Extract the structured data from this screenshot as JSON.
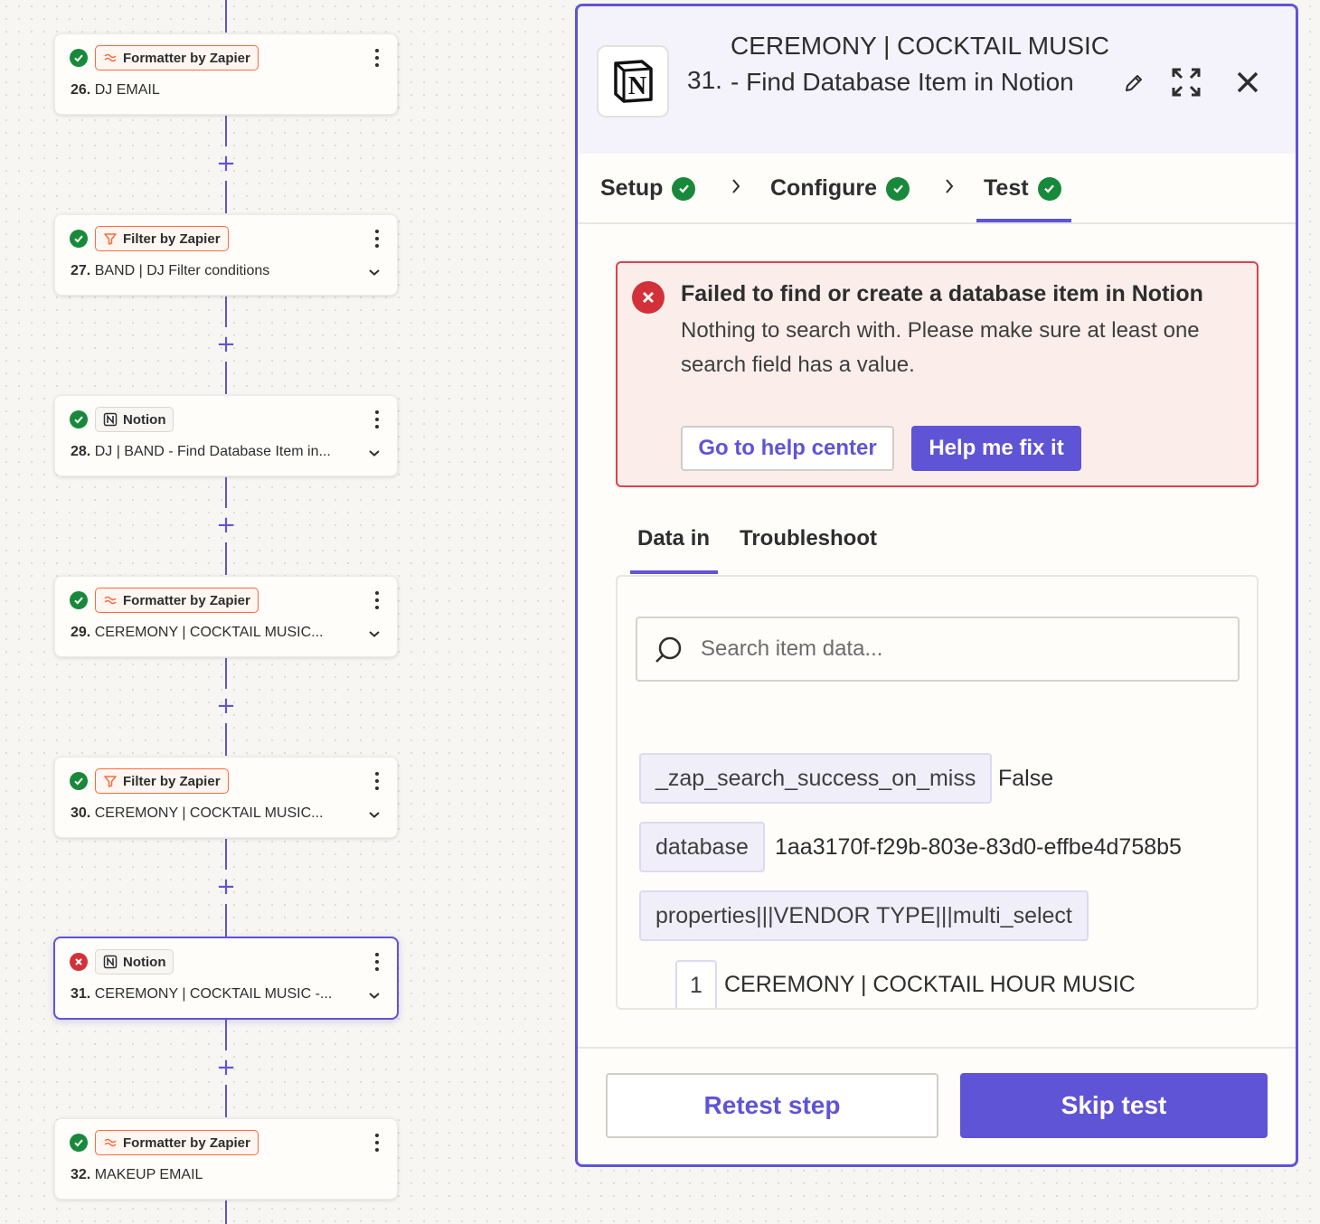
{
  "steps": [
    {
      "status": "success",
      "app": "Formatter by Zapier",
      "app_icon": "formatter-icon",
      "number": "26.",
      "title": "DJ EMAIL",
      "has_chevron": false
    },
    {
      "status": "success",
      "app": "Filter by Zapier",
      "app_icon": "filter-icon",
      "number": "27.",
      "title": "BAND | DJ Filter conditions",
      "has_chevron": true
    },
    {
      "status": "success",
      "app": "Notion",
      "app_icon": "notion-icon",
      "number": "28.",
      "title": "DJ | BAND - Find Database Item in...",
      "has_chevron": true
    },
    {
      "status": "success",
      "app": "Formatter by Zapier",
      "app_icon": "formatter-icon",
      "number": "29.",
      "title": "CEREMONY | COCKTAIL MUSIC...",
      "has_chevron": true
    },
    {
      "status": "success",
      "app": "Filter by Zapier",
      "app_icon": "filter-icon",
      "number": "30.",
      "title": "CEREMONY | COCKTAIL MUSIC...",
      "has_chevron": true
    },
    {
      "status": "error",
      "app": "Notion",
      "app_icon": "notion-icon",
      "number": "31.",
      "title": "CEREMONY | COCKTAIL MUSIC -...",
      "has_chevron": true,
      "selected": true
    },
    {
      "status": "success",
      "app": "Formatter by Zapier",
      "app_icon": "formatter-icon",
      "number": "32.",
      "title": "MAKEUP EMAIL",
      "has_chevron": false
    }
  ],
  "add_step_symbol": "+",
  "panel": {
    "number": "31.",
    "title": "CEREMONY | COCKTAIL MUSIC - Find Database Item in Notion",
    "app_icon": "notion-icon",
    "tabs": [
      {
        "label": "Setup",
        "status": "complete"
      },
      {
        "label": "Configure",
        "status": "complete"
      },
      {
        "label": "Test",
        "status": "complete",
        "active": true
      }
    ],
    "error": {
      "title": "Failed to find or create a database item in Notion",
      "message": "Nothing to search with. Please make sure at least one search field has a value.",
      "help_center_label": "Go to help center",
      "fix_label": "Help me fix it"
    },
    "subtabs": [
      {
        "label": "Data in",
        "active": true
      },
      {
        "label": "Troubleshoot",
        "active": false
      }
    ],
    "search": {
      "placeholder": "Search item data..."
    },
    "data": [
      {
        "key": "_zap_search_success_on_miss",
        "value": "False"
      },
      {
        "key": "database",
        "value": "1aa3170f-f29b-803e-83d0-effbe4d758b5"
      },
      {
        "key": "properties|||VENDOR TYPE|||multi_select",
        "value": ""
      },
      {
        "key": "1",
        "value": "CEREMONY | COCKTAIL HOUR MUSIC"
      }
    ],
    "retest_label": "Retest step",
    "skip_label": "Skip test"
  },
  "colors": {
    "accent": "#5f54d6",
    "success": "#18893b",
    "error": "#d3313a",
    "formatter_orange": "#ff6a3d"
  }
}
